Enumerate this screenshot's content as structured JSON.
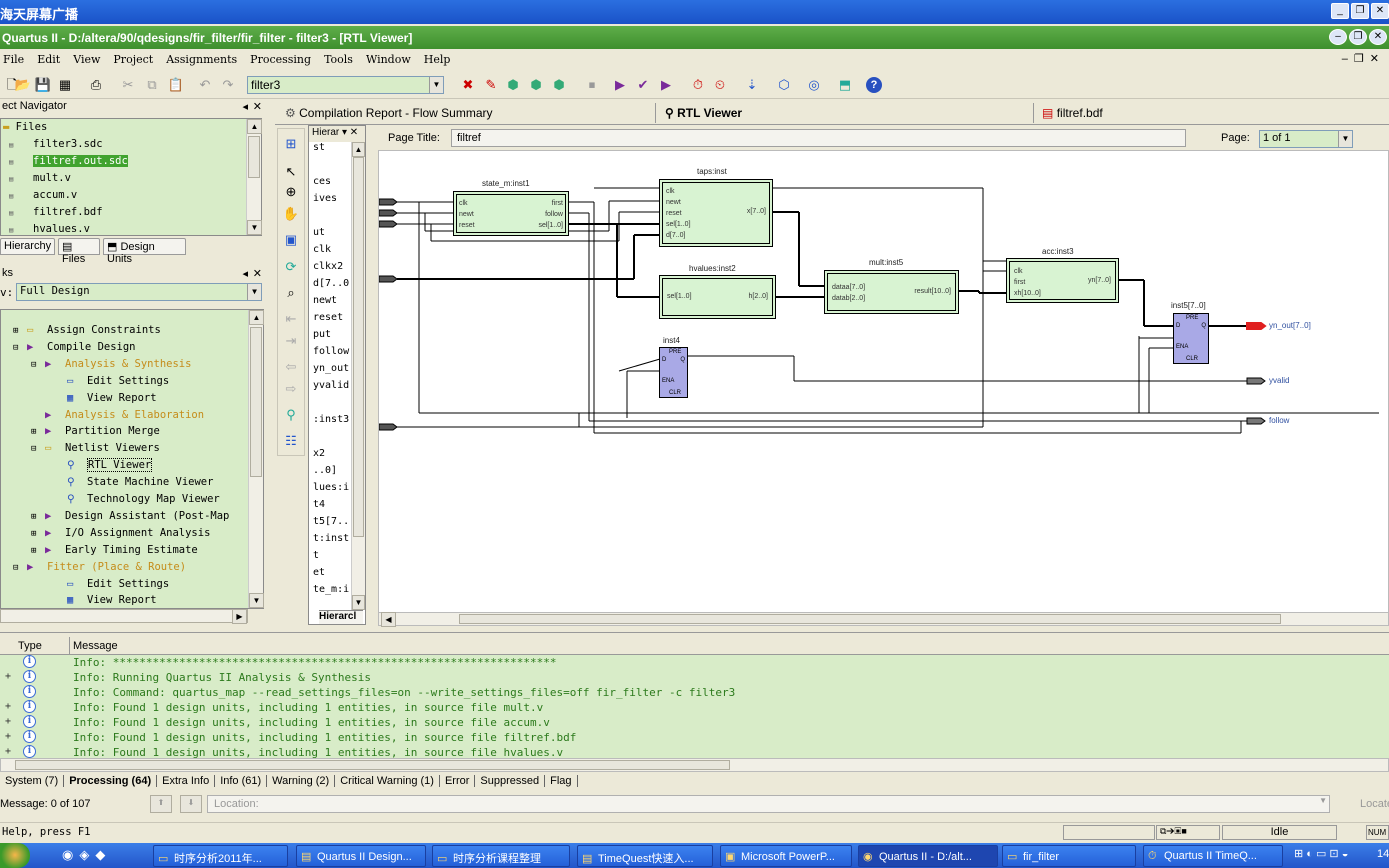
{
  "recorder": {
    "title": "海天屏幕广播"
  },
  "window": {
    "title": "Quartus II - D:/altera/90/qdesigns/fir_filter/fir_filter - filter3 - [RTL Viewer]"
  },
  "menu": [
    "File",
    "Edit",
    "View",
    "Project",
    "Assignments",
    "Processing",
    "Tools",
    "Window",
    "Help"
  ],
  "toolbar": {
    "entity_combo": "filter3"
  },
  "navigator": {
    "title": "ect Navigator",
    "files_header": "Files",
    "files": [
      "filter3.sdc",
      "filtref.out.sdc",
      "mult.v",
      "accum.v",
      "filtref.bdf",
      "hvalues.v"
    ],
    "tabs": [
      "Hierarchy",
      "Files",
      "Design Units"
    ]
  },
  "tasks": {
    "title": "ks",
    "flow_label": "v:",
    "flow_value": "Full Design",
    "items": [
      {
        "label": "Assign Constraints",
        "style": "normal"
      },
      {
        "label": "Compile Design",
        "style": "normal"
      },
      {
        "label": "Analysis & Synthesis",
        "style": "orange"
      },
      {
        "label": "Edit Settings",
        "style": "normal"
      },
      {
        "label": "View Report",
        "style": "normal"
      },
      {
        "label": "Analysis & Elaboration",
        "style": "orange"
      },
      {
        "label": "Partition Merge",
        "style": "normal"
      },
      {
        "label": "Netlist Viewers",
        "style": "normal"
      },
      {
        "label": "RTL Viewer",
        "style": "normal"
      },
      {
        "label": "State Machine Viewer",
        "style": "normal"
      },
      {
        "label": "Technology Map Viewer",
        "style": "normal"
      },
      {
        "label": "Design Assistant (Post-Map",
        "style": "normal"
      },
      {
        "label": "I/O Assignment Analysis",
        "style": "normal"
      },
      {
        "label": "Early Timing Estimate",
        "style": "normal"
      },
      {
        "label": "Fitter (Place & Route)",
        "style": "orange"
      },
      {
        "label": "Edit Settings",
        "style": "normal"
      },
      {
        "label": "View Report",
        "style": "normal"
      }
    ]
  },
  "hierarchy_panel": {
    "title": "Hierar",
    "tab": "Hierarcl",
    "items": [
      "st",
      "",
      "ces",
      "ives",
      "",
      "ut",
      "clk",
      "clkx2",
      "d[7..0",
      "newt",
      "reset",
      "put",
      "follow",
      "yn_out",
      "yvalid",
      "",
      ":inst3",
      "",
      "x2",
      "..0]",
      "lues:i",
      "t4",
      "t5[7..",
      "t:inst",
      "t",
      "et",
      "te_m:i"
    ]
  },
  "doc_tabs": [
    "Compilation Report - Flow Summary",
    "RTL Viewer",
    "filtref.bdf"
  ],
  "rtl": {
    "page_title_label": "Page Title:",
    "page_title_value": "filtref",
    "page_label": "Page:",
    "page_value": "1 of 1",
    "blocks": {
      "state_m": {
        "name": "state_m:inst1",
        "ports_left": [
          "clk",
          "newt",
          "reset"
        ],
        "ports_right": [
          "first",
          "follow",
          "sel[1..0]"
        ]
      },
      "taps": {
        "name": "taps:inst",
        "ports_left": [
          "clk",
          "newt",
          "reset",
          "sel[1..0]",
          "d[7..0]"
        ],
        "ports_right": [
          "x[7..0]"
        ]
      },
      "hvalues": {
        "name": "hvalues:inst2",
        "ports_left": [
          "sel[1..0]"
        ],
        "ports_right": [
          "h[2..0]"
        ]
      },
      "mult": {
        "name": "mult:inst5",
        "ports_left": [
          "dataa[7..0]",
          "datab[2..0]"
        ],
        "ports_right": [
          "result[10..0]"
        ]
      },
      "acc": {
        "name": "acc:inst3",
        "ports_left": [
          "clk",
          "first",
          "xh[10..0]"
        ],
        "ports_right": [
          "yn[7..0]"
        ]
      },
      "inst4": {
        "name": "inst4",
        "pins": [
          "PRE",
          "D",
          "Q",
          "ENA",
          "CLR"
        ]
      },
      "inst5": {
        "name": "inst5[7..0]",
        "pins": [
          "PRE",
          "D",
          "Q",
          "ENA",
          "CLR"
        ]
      }
    },
    "outputs": [
      "yn_out[7..0]",
      "yvalid",
      "follow"
    ]
  },
  "messages": {
    "headers": [
      "Type",
      "Message"
    ],
    "rows": [
      {
        "expand": "",
        "text": "Info: *******************************************************************"
      },
      {
        "expand": "+",
        "text": "Info: Running Quartus II Analysis & Synthesis"
      },
      {
        "expand": "",
        "text": "Info: Command: quartus_map --read_settings_files=on --write_settings_files=off fir_filter -c filter3"
      },
      {
        "expand": "+",
        "text": "Info: Found 1 design units, including 1 entities, in source file mult.v"
      },
      {
        "expand": "+",
        "text": "Info: Found 1 design units, including 1 entities, in source file accum.v"
      },
      {
        "expand": "+",
        "text": "Info: Found 1 design units, including 1 entities, in source file filtref.bdf"
      },
      {
        "expand": "+",
        "text": "Info: Found 1 design units, including 1 entities, in source file hvalues.v"
      }
    ],
    "tabs": [
      "System (7)",
      "Processing (64)",
      "Extra Info",
      "Info (61)",
      "Warning (2)",
      "Critical Warning (1)",
      "Error",
      "Suppressed",
      "Flag"
    ],
    "active_tab": "Processing (64)",
    "message_count": "Message: 0 of 107",
    "location_placeholder": "Location:",
    "locate_button": "Locate"
  },
  "status": {
    "help": "Help, press F1",
    "state": "Idle",
    "num": "NUM"
  },
  "taskbar": {
    "items": [
      "时序分析2011年...",
      "Quartus II Design...",
      "时序分析课程整理",
      "TimeQuest快速入...",
      "Microsoft PowerP...",
      "Quartus II - D:/alt...",
      "fir_filter",
      "Quartus II TimeQ..."
    ],
    "active": "Quartus II - D:/alt...",
    "clock": "14"
  },
  "colors": {
    "quartus_green": "#41a32f",
    "panel_green": "#d8ecc8",
    "block_fill": "#d8f3d2",
    "register_fill": "#a9a9e6",
    "output_red": "#e02020"
  }
}
